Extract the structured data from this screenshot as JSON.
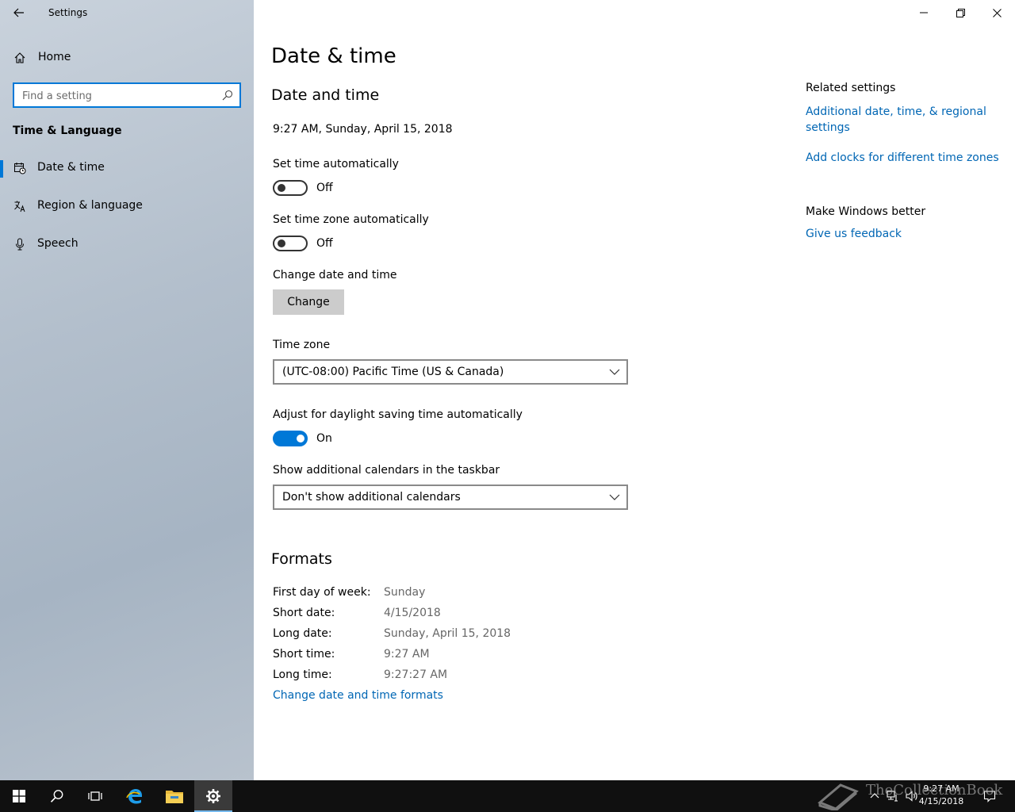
{
  "window": {
    "title": "Settings",
    "minimize_icon": "minimize-icon",
    "restore_icon": "restore-icon",
    "close_icon": "close-icon"
  },
  "sidebar": {
    "home_label": "Home",
    "search_placeholder": "Find a setting",
    "section_title": "Time & Language",
    "items": [
      {
        "label": "Date & time",
        "icon": "calendar-clock-icon",
        "selected": true
      },
      {
        "label": "Region & language",
        "icon": "language-icon",
        "selected": false
      },
      {
        "label": "Speech",
        "icon": "microphone-icon",
        "selected": false
      }
    ]
  },
  "main": {
    "page_title": "Date & time",
    "section_date_time": "Date and time",
    "current_datetime": "9:27 AM, Sunday, April 15, 2018",
    "set_time_auto": {
      "label": "Set time automatically",
      "state": "Off"
    },
    "set_timezone_auto": {
      "label": "Set time zone automatically",
      "state": "Off"
    },
    "change_date_time": {
      "label": "Change date and time",
      "button": "Change"
    },
    "time_zone": {
      "label": "Time zone",
      "value": "(UTC-08:00) Pacific Time (US & Canada)"
    },
    "daylight": {
      "label": "Adjust for daylight saving time automatically",
      "state": "On"
    },
    "calendars": {
      "label": "Show additional calendars in the taskbar",
      "value": "Don't show additional calendars"
    },
    "formats": {
      "title": "Formats",
      "rows": [
        {
          "label": "First day of week:",
          "value": "Sunday"
        },
        {
          "label": "Short date:",
          "value": "4/15/2018"
        },
        {
          "label": "Long date:",
          "value": "Sunday, April 15, 2018"
        },
        {
          "label": "Short time:",
          "value": "9:27 AM"
        },
        {
          "label": "Long time:",
          "value": "9:27:27 AM"
        }
      ],
      "change_link": "Change date and time formats"
    }
  },
  "related": {
    "title": "Related settings",
    "link_additional": "Additional date, time, & regional settings",
    "link_clocks": "Add clocks for different time zones",
    "feedback_title": "Make Windows better",
    "feedback_link": "Give us feedback"
  },
  "taskbar": {
    "clock_time": "9:27 AM",
    "clock_date": "4/15/2018",
    "watermark": "TheCollectionBook"
  },
  "colors": {
    "accent": "#0078d7",
    "link": "#0066b4"
  }
}
